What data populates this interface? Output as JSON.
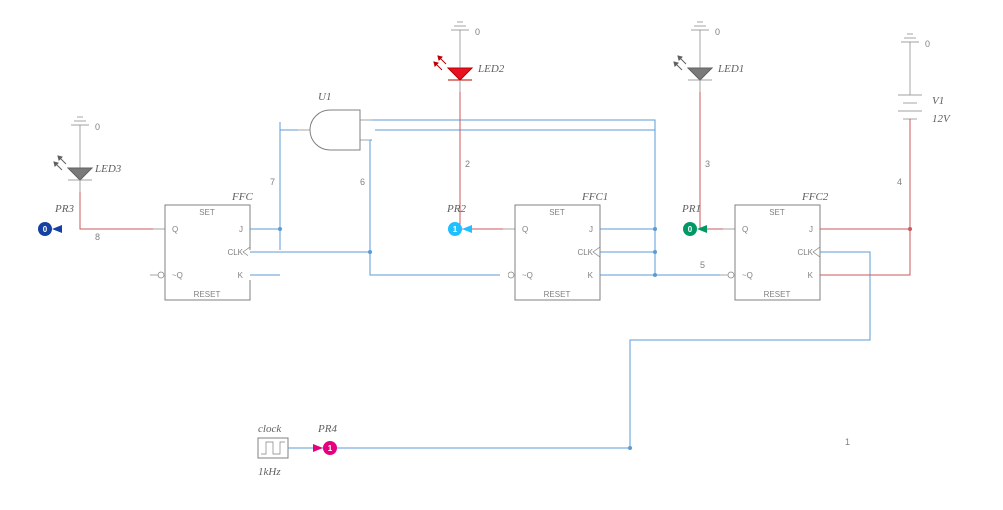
{
  "chart_data": {
    "type": "schematic",
    "title": "",
    "components": [
      {
        "ref": "FFC",
        "type": "JK flip-flop",
        "ports": [
          "SET",
          "J",
          "CLK",
          "K",
          "RESET",
          "Q",
          "~Q"
        ]
      },
      {
        "ref": "FFC1",
        "type": "JK flip-flop",
        "ports": [
          "SET",
          "J",
          "CLK",
          "K",
          "RESET",
          "Q",
          "~Q"
        ]
      },
      {
        "ref": "FFC2",
        "type": "JK flip-flop",
        "ports": [
          "SET",
          "J",
          "CLK",
          "K",
          "RESET",
          "Q",
          "~Q"
        ]
      },
      {
        "ref": "U1",
        "type": "AND gate 2-in"
      },
      {
        "ref": "LED1",
        "type": "LED",
        "state": "off"
      },
      {
        "ref": "LED2",
        "type": "LED",
        "state": "on"
      },
      {
        "ref": "LED3",
        "type": "LED",
        "state": "off"
      },
      {
        "ref": "V1",
        "type": "DC source",
        "value": "12V"
      },
      {
        "ref": "clock",
        "type": "Clock source",
        "value": "1kHz"
      }
    ],
    "probes": [
      {
        "ref": "PR1",
        "value": 0,
        "color": "#009966"
      },
      {
        "ref": "PR2",
        "value": 1,
        "color": "#1ec0ff"
      },
      {
        "ref": "PR3",
        "value": 0,
        "color": "#1540a4"
      },
      {
        "ref": "PR4",
        "value": 1,
        "color": "#e6007e"
      }
    ],
    "grounds": [
      {
        "net": "0",
        "near": "LED1"
      },
      {
        "net": "0",
        "near": "LED2"
      },
      {
        "net": "0",
        "near": "LED3"
      },
      {
        "net": "0",
        "near": "V1"
      }
    ],
    "nets": [
      "1",
      "2",
      "3",
      "4",
      "5",
      "6",
      "7",
      "8"
    ],
    "connections": [
      "clock → PR4 → net1 → FFC2.CLK",
      "V1(+) → net4 → FFC2.J, FFC2.K",
      "FFC2.Q → net3 → LED1 anode, PR1",
      "FFC2.~Q → net5 → FFC1.J, FFC1.K, FFC1.CLK, U1.in2",
      "FFC1.Q → net2 → LED2 anode, PR2",
      "FFC1.~Q → net6 → U1.in1 (via net7 leg), FFC.CLK",
      "U1.out → net7 → FFC.J, FFC.K",
      "FFC.Q → net8 → LED3 anode, PR3",
      "LED1,LED2,LED3 cathode → GND(0)",
      "V1(−) → GND(0)"
    ]
  },
  "labels": {
    "FFC": "FFC",
    "FFC1": "FFC1",
    "FFC2": "FFC2",
    "U1": "U1",
    "LED1": "LED1",
    "LED2": "LED2",
    "LED3": "LED3",
    "V1": "V1",
    "V1v": "12V",
    "clock": "clock",
    "clkv": "1kHz",
    "PR1": "PR1",
    "PR2": "PR2",
    "PR3": "PR3",
    "PR4": "PR4",
    "gnd": "0",
    "ff": {
      "SET": "SET",
      "J": "J",
      "CLK": "CLK",
      "K": "K",
      "RESET": "RESET",
      "Q": "Q",
      "NQ": "~Q"
    },
    "net": {
      "n1": "1",
      "n2": "2",
      "n3": "3",
      "n4": "4",
      "n5": "5",
      "n6": "6",
      "n7": "7",
      "n8": "8"
    },
    "pr": {
      "v0": "0",
      "v1": "1"
    }
  }
}
